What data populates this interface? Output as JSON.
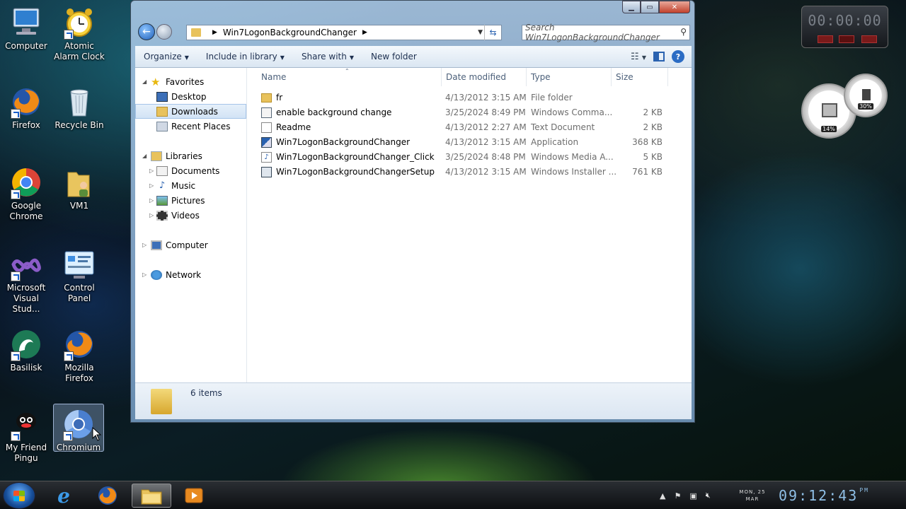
{
  "desktop": {
    "icons": [
      {
        "label": "Computer",
        "icon": "computer-icon"
      },
      {
        "label": "Atomic Alarm Clock",
        "icon": "alarm-clock-icon"
      },
      {
        "label": "Firefox",
        "icon": "firefox-icon"
      },
      {
        "label": "Recycle Bin",
        "icon": "recycle-bin-icon"
      },
      {
        "label": "Google Chrome",
        "icon": "chrome-icon"
      },
      {
        "label": "VM1",
        "icon": "user-folder-icon"
      },
      {
        "label": "Microsoft Visual Stud...",
        "icon": "visual-studio-icon"
      },
      {
        "label": "Control Panel",
        "icon": "control-panel-icon"
      },
      {
        "label": "Basilisk",
        "icon": "basilisk-icon"
      },
      {
        "label": "Mozilla Firefox",
        "icon": "firefox-icon"
      },
      {
        "label": "My Friend Pingu",
        "icon": "pingu-icon"
      },
      {
        "label": "Chromium",
        "icon": "chromium-icon"
      }
    ]
  },
  "explorer": {
    "breadcrumb": "Win7LogonBackgroundChanger",
    "search_placeholder": "Search Win7LogonBackgroundChanger",
    "toolbar": {
      "organize": "Organize",
      "include_in_library": "Include in library",
      "share_with": "Share with",
      "new_folder": "New folder"
    },
    "nav": {
      "favorites": "Favorites",
      "desktop": "Desktop",
      "downloads": "Downloads",
      "recent_places": "Recent Places",
      "libraries": "Libraries",
      "documents": "Documents",
      "music": "Music",
      "pictures": "Pictures",
      "videos": "Videos",
      "computer": "Computer",
      "network": "Network"
    },
    "columns": {
      "name": "Name",
      "date_modified": "Date modified",
      "type": "Type",
      "size": "Size"
    },
    "files": [
      {
        "name": "fr",
        "date": "4/13/2012 3:15 AM",
        "type": "File folder",
        "size": "",
        "icon": "folder-icon"
      },
      {
        "name": "enable background change",
        "date": "3/25/2024 8:49 PM",
        "type": "Windows Comma...",
        "size": "2 KB",
        "icon": "command-script-icon"
      },
      {
        "name": "Readme",
        "date": "4/13/2012 2:27 AM",
        "type": "Text Document",
        "size": "2 KB",
        "icon": "text-document-icon"
      },
      {
        "name": "Win7LogonBackgroundChanger",
        "date": "4/13/2012 3:15 AM",
        "type": "Application",
        "size": "368 KB",
        "icon": "application-icon"
      },
      {
        "name": "Win7LogonBackgroundChanger_Click",
        "date": "3/25/2024 8:48 PM",
        "type": "Windows Media A...",
        "size": "5 KB",
        "icon": "media-audio-icon"
      },
      {
        "name": "Win7LogonBackgroundChangerSetup",
        "date": "4/13/2012 3:15 AM",
        "type": "Windows Installer ...",
        "size": "761 KB",
        "icon": "installer-icon"
      }
    ],
    "status": "6 items"
  },
  "gadgets": {
    "stopwatch": "00:00:00",
    "btn1": "00",
    "btn3": "00",
    "cpu_gauge": "14%",
    "mem_gauge": "30%"
  },
  "taskbar": {
    "date_line1": "MON, 25",
    "date_line2": "MAR",
    "time": "09:12:43",
    "ampm": "PM"
  }
}
